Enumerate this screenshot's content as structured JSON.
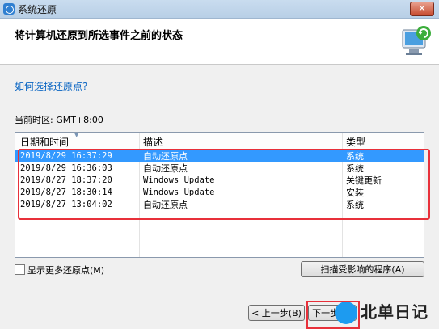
{
  "window": {
    "title": "系统还原",
    "close_label": "✕"
  },
  "header": {
    "heading": "将计算机还原到所选事件之前的状态",
    "icon": "system-restore-icon"
  },
  "help_link": "如何选择还原点?",
  "timezone": "当前时区: GMT+8:00",
  "table": {
    "columns": [
      "日期和时间",
      "描述",
      "类型"
    ],
    "rows": [
      {
        "datetime": "2019/8/29 16:37:29",
        "description": "自动还原点",
        "type": "系统",
        "selected": true
      },
      {
        "datetime": "2019/8/29 16:36:03",
        "description": "自动还原点",
        "type": "系统"
      },
      {
        "datetime": "2019/8/27 18:37:20",
        "description": "Windows Update",
        "type": "关键更新"
      },
      {
        "datetime": "2019/8/27 18:30:14",
        "description": "Windows Update",
        "type": "安装"
      },
      {
        "datetime": "2019/8/27 13:04:02",
        "description": "自动还原点",
        "type": "系统"
      }
    ]
  },
  "show_more": "显示更多还原点(M)",
  "scan_button": "扫描受影响的程序(A)",
  "back_button": "< 上一步(B)",
  "next_button": "下一步(N)",
  "watermark": "北单日记",
  "colors": {
    "selection": "#3399ff",
    "highlight_box": "#e8303a",
    "link": "#0b66c3"
  }
}
